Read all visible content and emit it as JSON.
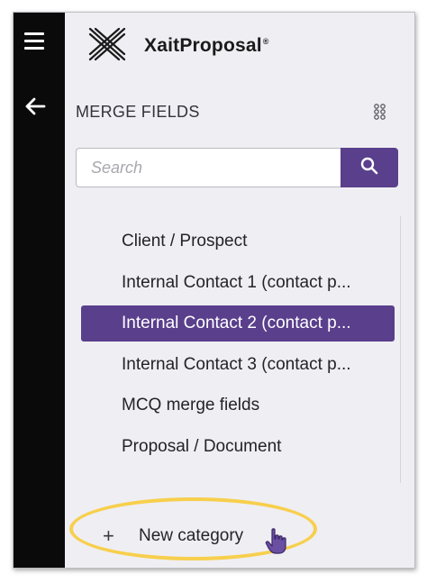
{
  "app": {
    "name": "XaitProposal",
    "trademark": "®"
  },
  "rail": {
    "menu_icon": "hamburger-menu-icon",
    "back_icon": "arrow-left-icon"
  },
  "panel": {
    "title": "MERGE FIELDS",
    "view_toggle_icon": "grid-dots-icon",
    "search": {
      "placeholder": "Search",
      "value": "",
      "button_icon": "search-icon"
    },
    "categories": [
      {
        "label": "Client / Prospect",
        "selected": false
      },
      {
        "label": "Internal Contact 1 (contact p...",
        "selected": false
      },
      {
        "label": "Internal Contact 2 (contact p...",
        "selected": true
      },
      {
        "label": "Internal Contact 3 (contact p...",
        "selected": false
      },
      {
        "label": "MCQ merge fields",
        "selected": false
      },
      {
        "label": "Proposal / Document",
        "selected": false
      }
    ],
    "new_category": {
      "icon": "+",
      "label": "New category"
    }
  },
  "colors": {
    "accent": "#5a3f8c",
    "rail": "#0a0a0b",
    "panel_bg": "#efeef3",
    "highlight": "#f7cf4c"
  }
}
